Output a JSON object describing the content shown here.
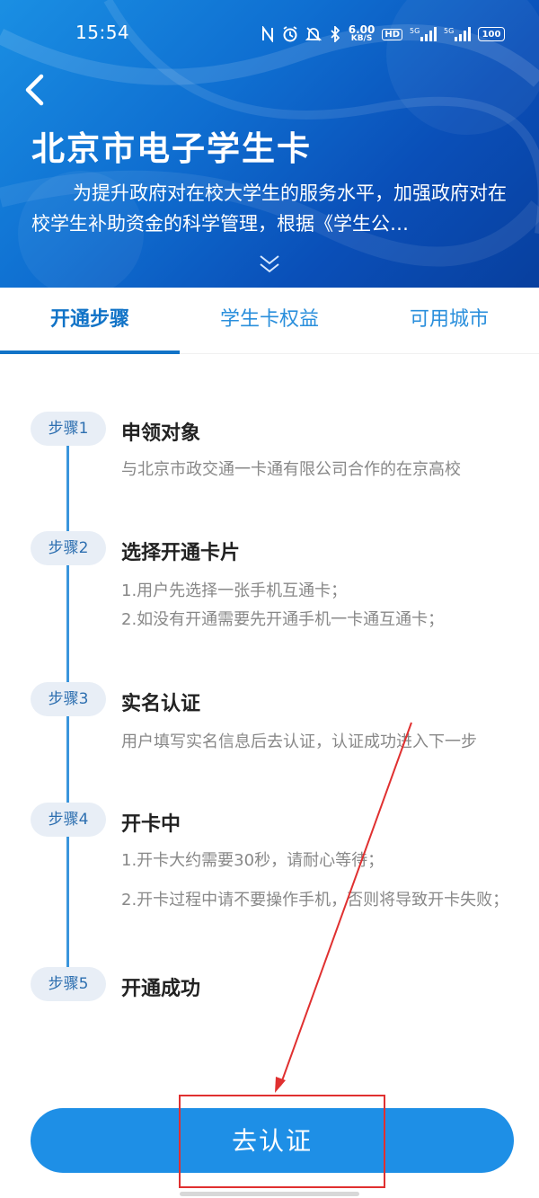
{
  "status_bar": {
    "time": "15:54",
    "net_speed_value": "6.00",
    "net_speed_unit": "KB/S",
    "hd_label": "HD",
    "sim1_label": "5G",
    "sim2_label": "5G",
    "battery": "100"
  },
  "header": {
    "title": "北京市电子学生卡",
    "description": "为提升政府对在校大学生的服务水平，加强政府对在校学生补助资金的科学管理，根据《学生公…"
  },
  "tabs": [
    {
      "label": "开通步骤",
      "active": true
    },
    {
      "label": "学生卡权益",
      "active": false
    },
    {
      "label": "可用城市",
      "active": false
    }
  ],
  "steps": [
    {
      "badge": "步骤1",
      "title": "申领对象",
      "lines": [
        "与北京市政交通一卡通有限公司合作的在京高校"
      ]
    },
    {
      "badge": "步骤2",
      "title": "选择开通卡片",
      "lines": [
        "1.用户先选择一张手机互通卡；",
        "2.如没有开通需要先开通手机一卡通互通卡；"
      ]
    },
    {
      "badge": "步骤3",
      "title": "实名认证",
      "lines": [
        "用户填写实名信息后去认证，认证成功进入下一步"
      ]
    },
    {
      "badge": "步骤4",
      "title": "开卡中",
      "lines": [
        "1.开卡大约需要30秒，请耐心等待；",
        "2.开卡过程中请不要操作手机，否则将导致开卡失败；"
      ]
    },
    {
      "badge": "步骤5",
      "title": "开通成功",
      "lines": []
    }
  ],
  "cta": {
    "label": "去认证"
  },
  "colors": {
    "primary": "#1e8fe6",
    "tab_active": "#1173c7",
    "timeline": "#3a95dc",
    "annotation": "#e03030"
  }
}
